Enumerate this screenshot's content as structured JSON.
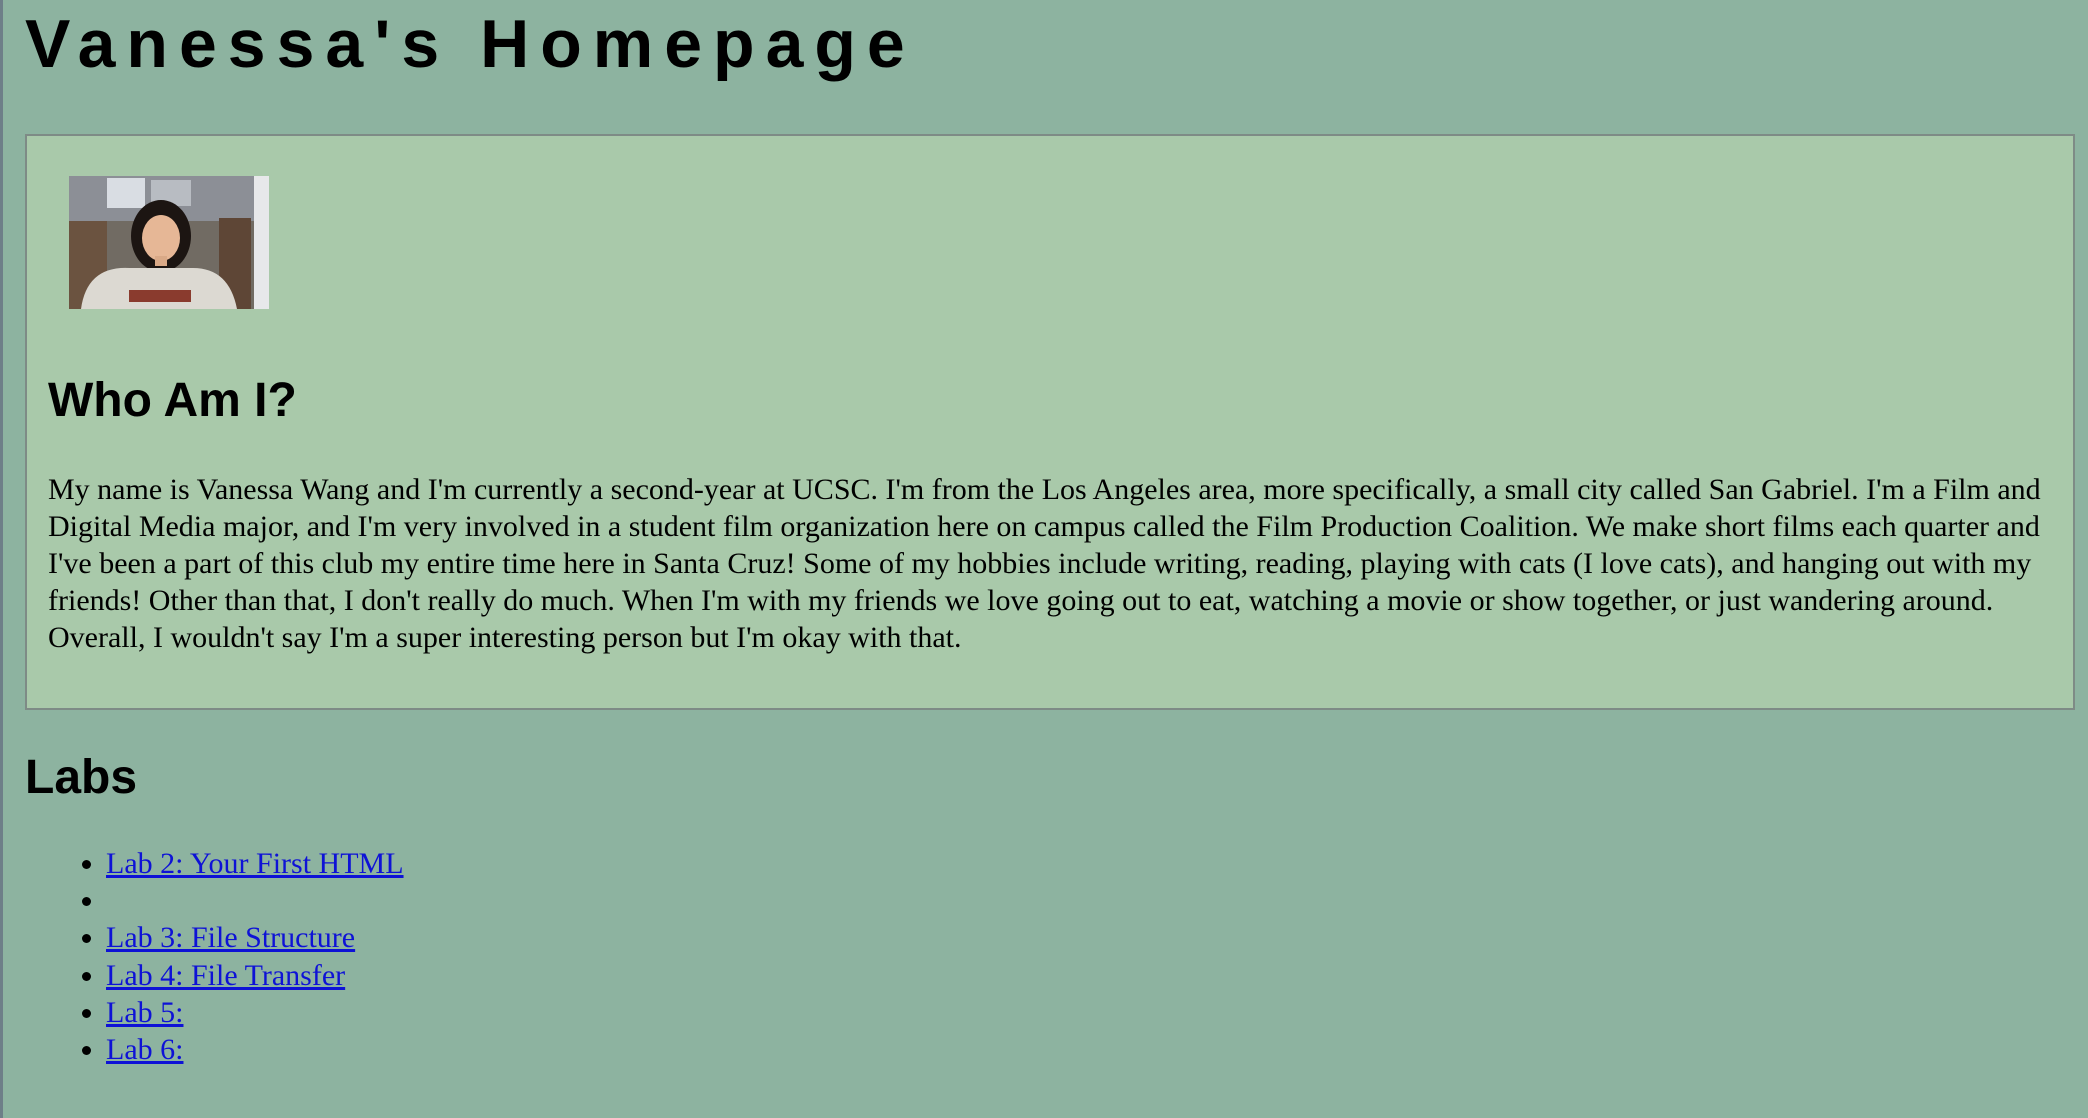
{
  "header": {
    "title": "Vanessa's Homepage"
  },
  "about": {
    "photo_alt": "photo of Vanessa",
    "heading": "Who Am I?",
    "text": "My name is Vanessa Wang and I'm currently a second-year at UCSC. I'm from the Los Angeles area, more specifically, a small city called San Gabriel. I'm a Film and Digital Media major, and I'm very involved in a student film organization here on campus called the Film Production Coalition. We make short films each quarter and I've been a part of this club my entire time here in Santa Cruz! Some of my hobbies include writing, reading, playing with cats (I love cats), and hanging out with my friends! Other than that, I don't really do much. When I'm with my friends we love going out to eat, watching a movie or show together, or just wandering around. Overall, I wouldn't say I'm a super interesting person but I'm okay with that."
  },
  "labs": {
    "heading": "Labs",
    "items": [
      {
        "label": "Lab 2: Your First HTML"
      },
      {
        "label": ""
      },
      {
        "label": "Lab 3: File Structure"
      },
      {
        "label": "Lab 4: File Transfer"
      },
      {
        "label": "Lab 5:"
      },
      {
        "label": "Lab 6:"
      }
    ]
  },
  "colors": {
    "page_background": "#8db3a0",
    "box_background": "#a9c9aa",
    "link": "#0e12d6"
  }
}
